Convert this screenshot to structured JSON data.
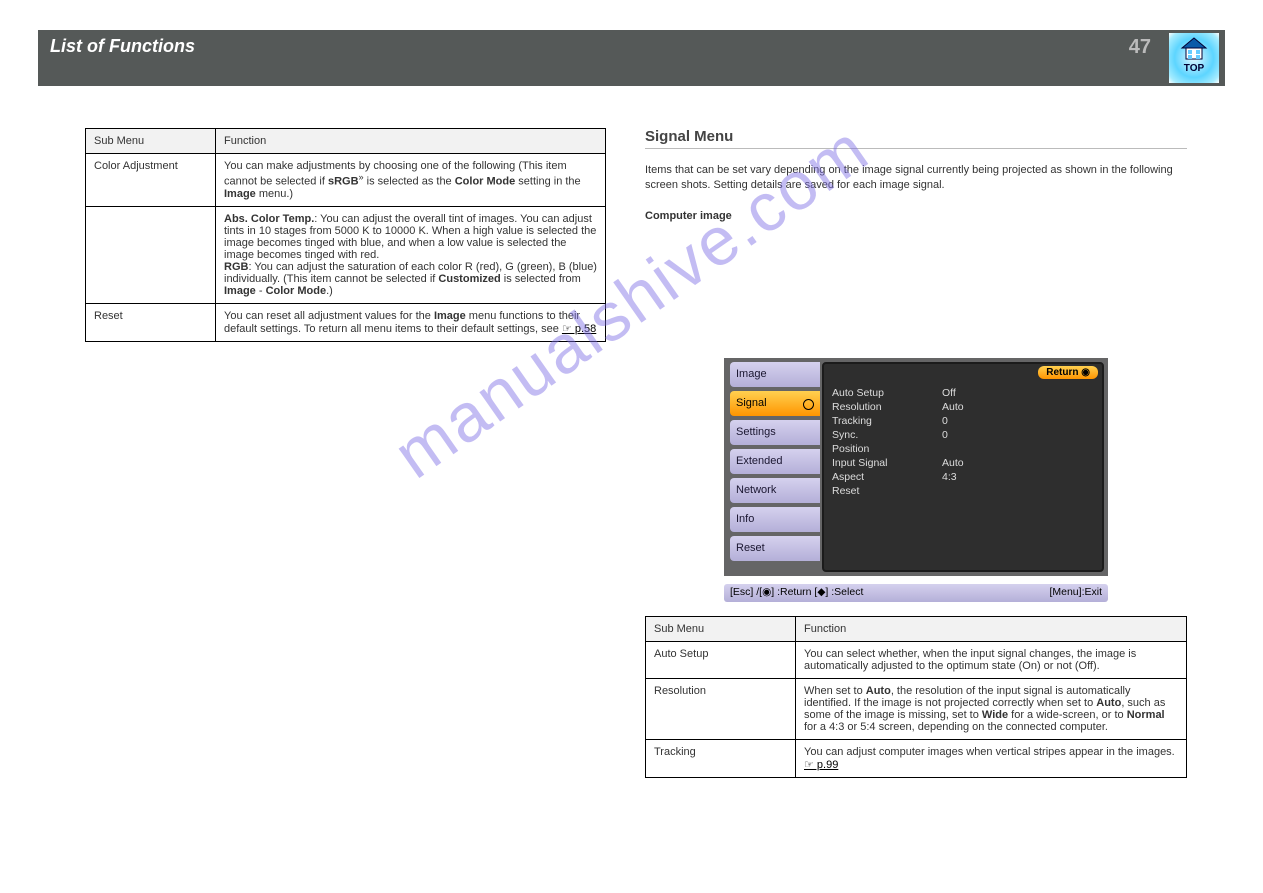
{
  "header": {
    "title": "List of Functions",
    "page_number": "47",
    "top_label": "TOP"
  },
  "left_table": {
    "col_submenu": "Sub Menu",
    "col_function": "Function",
    "rows": [
      {
        "submenu": "Color Adjustment",
        "function_html": "You can make adjustments by choosing one of the following (This item cannot be selected if <b>sRGB</b><sup>»</sup> is selected as the <b>Color Mode</b> setting in the <b>Image</b> menu.)"
      },
      {
        "submenu": "",
        "function_html": "<b>Abs. Color Temp.</b>: You can adjust the overall tint of images. You can adjust tints in 10 stages from 5000 K to 10000 K. When a high value is selected the image becomes tinged with blue, and when a low value is selected the image becomes tinged with red.<br><b>RGB</b>: You can adjust the saturation of each color R (red), G (green), B (blue) individually. (This item cannot be selected if <b>Customized</b> is selected from <b>Image</b> - <b>Color Mode</b>.)"
      },
      {
        "submenu": "Reset",
        "function_html": "You can reset all adjustment values for the <b>Image</b> menu functions to their default settings. To return all menu items to their default settings, see <span class='plink'>☞ p.58</span>"
      }
    ]
  },
  "right": {
    "section_title": "Signal Menu",
    "note": "Items that can be set vary depending on the image signal currently being projected as shown in the following screen shots. Setting details are saved for each image signal.",
    "computer_label": "Computer image"
  },
  "osd": {
    "tabs": [
      "Image",
      "Signal",
      "Settings",
      "Extended",
      "Network",
      "Info",
      "Reset"
    ],
    "selected_idx": 1,
    "return": "Return",
    "rows": [
      {
        "k": "Auto Setup",
        "v": "Off"
      },
      {
        "k": "Resolution",
        "v": "Auto"
      },
      {
        "k": "Tracking",
        "v": "0"
      },
      {
        "k": "Sync.",
        "v": "0"
      },
      {
        "k": "Position",
        "v": ""
      },
      {
        "k": "Input Signal",
        "v": "Auto"
      },
      {
        "k": "Aspect",
        "v": "4:3"
      },
      {
        "k": "Reset",
        "v": ""
      }
    ],
    "footer_left": "[Esc] /[◉] :Return  [◆] :Select",
    "footer_right": "[Menu]:Exit"
  },
  "right_table": {
    "col_submenu": "Sub Menu",
    "col_function": "Function",
    "rows": [
      {
        "submenu": "Auto Setup",
        "function": "You can select whether, when the input signal changes, the image is automatically adjusted to the optimum state (On) or not (Off)."
      },
      {
        "submenu": "Resolution",
        "function_html": "When set to <b>Auto</b>, the resolution of the input signal is automatically identified. If the image is not projected correctly when set to <b>Auto</b>, such as some of the image is missing, set to <b>Wide</b> for a wide-screen, or to <b>Normal</b> for a 4:3 or 5:4 screen, depending on the connected computer."
      },
      {
        "submenu": "Tracking",
        "function_html": "You can adjust computer images when vertical stripes appear in the images. <span class='plink'>☞ p.99</span>"
      }
    ]
  },
  "watermark": "manualshive.com"
}
